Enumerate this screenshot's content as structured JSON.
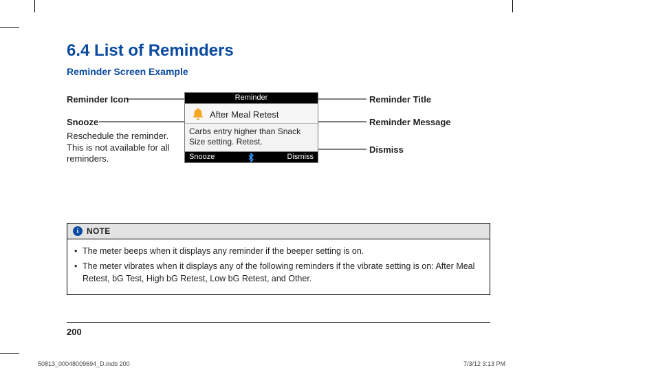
{
  "section_title": "6.4 List of Reminders",
  "subheading": "Reminder Screen Example",
  "callouts": {
    "icon": {
      "label": "Reminder Icon"
    },
    "snooze": {
      "label": "Snooze",
      "desc": "Reschedule the reminder. This is not available for all reminders."
    },
    "title": {
      "label": "Reminder Title"
    },
    "message": {
      "label": "Reminder Message"
    },
    "dismiss": {
      "label": "Dismiss"
    }
  },
  "device": {
    "titlebar": "Reminder",
    "message_title": "After Meal Retest",
    "message_body": "Carbs entry higher than Snack Size setting. Retest.",
    "snooze": "Snooze",
    "dismiss": "Dismiss"
  },
  "note": {
    "label": "NOTE",
    "items": [
      "The meter beeps when it displays any reminder if the beeper setting is on.",
      "The meter vibrates when it displays any of the following reminders if the vibrate setting is on: After Meal Retest, bG Test, High bG Retest, Low bG Retest, and Other."
    ]
  },
  "page_number": "200",
  "imprint": {
    "file": "50813_00048009694_D.indb   200",
    "datetime": "7/3/12   3:13 PM"
  }
}
